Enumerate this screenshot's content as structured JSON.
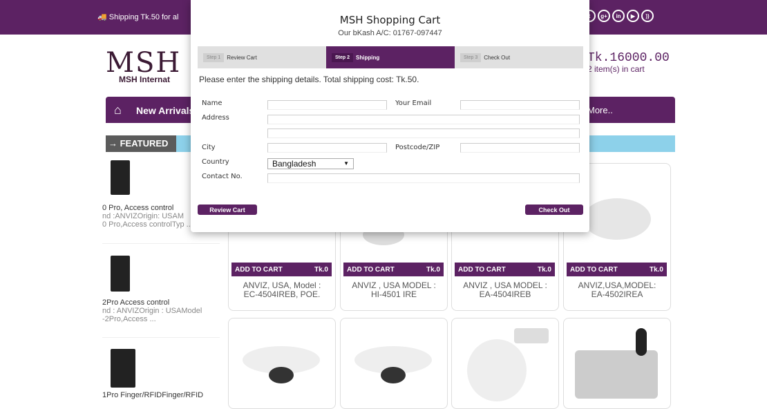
{
  "topbar": {
    "shipping_note": "Shipping Tk.50 for al",
    "social_icons": [
      "twitter-icon",
      "google-plus-icon",
      "linkedin-icon",
      "youtube-icon",
      "rss-icon"
    ]
  },
  "brand": {
    "logo_text": "MSH",
    "logo_sub": "MSH Internat"
  },
  "cart": {
    "total": "Tk.16000.00",
    "count": "2 item(s) in cart"
  },
  "nav": {
    "new_arrivals": "New Arrivals",
    "more": "More.."
  },
  "featured": {
    "tab_label": "→ FEATURED"
  },
  "sidebar": {
    "items": [
      {
        "line1": "0 Pro, Access control",
        "line2": "nd :ANVIZOrigin: USAM",
        "line3": "0 Pro,Access controlTyp ..."
      },
      {
        "line1": "2Pro Access control",
        "line2": "nd : ANVIZOrigin : USAModel",
        "line3": "-2Pro,Access ..."
      },
      {
        "line1": "1Pro  Finger/RFIDFinger/RFID"
      }
    ]
  },
  "products": {
    "row1": [
      {
        "cart_label": "ADD TO CART",
        "price": "Tk.0",
        "name_line1": "ANVIZ, USA, Model :",
        "name_line2": "EC-4504IREB, POE."
      },
      {
        "cart_label": "ADD TO CART",
        "price": "Tk.0",
        "name_line1": "ANVIZ , USA MODEL :",
        "name_line2": "HI-4501 IRE"
      },
      {
        "cart_label": "ADD TO CART",
        "price": "Tk.0",
        "name_line1": "ANVIZ , USA MODEL :",
        "name_line2": "EA-4504IREB"
      },
      {
        "cart_label": "ADD TO CART",
        "price": "Tk.0",
        "name_line1": "ANVIZ,USA,MODEL:",
        "name_line2": "EA-4502IREA"
      }
    ]
  },
  "modal": {
    "title": "MSH Shopping Cart",
    "subtitle": "Our bKash A/C: 01767-097447",
    "steps": [
      {
        "tag": "Step 1",
        "label": "Review Cart"
      },
      {
        "tag": "Step 2",
        "label": "Shipping"
      },
      {
        "tag": "Step 3",
        "label": "Check Out"
      }
    ],
    "intro": "Please enter the shipping details. Total shipping cost: Tk.50.",
    "fields": {
      "name": "Name",
      "email": "Your Email",
      "address": "Address",
      "city": "City",
      "postcode": "Postcode/ZIP",
      "country": "Country",
      "contact": "Contact No."
    },
    "country_value": "Bangladesh",
    "review_button": "Review Cart",
    "checkout_button": "Check Out"
  }
}
